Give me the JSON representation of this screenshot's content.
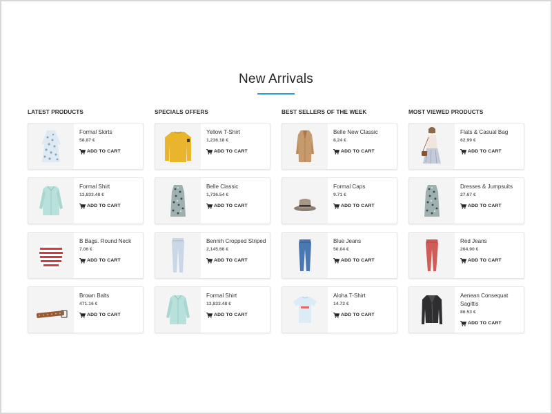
{
  "page": {
    "title": "New Arrivals",
    "accent_color": "#2a9fd6"
  },
  "add_to_cart_label": "ADD TO CART",
  "columns": [
    {
      "heading": "LATEST PRODUCTS",
      "products": [
        {
          "name": "Formal Skirts",
          "price": "58.87 €",
          "image": "floral-dress-image"
        },
        {
          "name": "Formal Shirt",
          "price": "13,833.48 €",
          "image": "mint-shirt-image"
        },
        {
          "name": "B Bags. Round Neck",
          "price": "7.06 €",
          "image": "striped-sweater-image"
        },
        {
          "name": "Brown Balts",
          "price": "471.16 €",
          "image": "brown-belt-image"
        }
      ]
    },
    {
      "heading": "SPECIALS OFFERS",
      "products": [
        {
          "name": "Yellow T-Shirt",
          "price": "1,236.18 €",
          "image": "yellow-sweater-image"
        },
        {
          "name": "Belle Classic",
          "price": "1,736.54 €",
          "image": "printed-dress-image"
        },
        {
          "name": "Bennih Cropped Striped",
          "price": "2,145.66 €",
          "image": "light-jeans-image"
        },
        {
          "name": "Formal Shirt",
          "price": "13,833.48 €",
          "image": "mint-shirt-image"
        }
      ]
    },
    {
      "heading": "BEST SELLERS OF THE WEEK",
      "products": [
        {
          "name": "Belle New Classic",
          "price": "8.24 €",
          "image": "camel-coat-image"
        },
        {
          "name": "Formal Caps",
          "price": "9.71 €",
          "image": "fedora-hat-image"
        },
        {
          "name": "Blue Jeans",
          "price": "50.04 €",
          "image": "blue-jeans-image"
        },
        {
          "name": "Aloha T-Shirt",
          "price": "14.72 €",
          "image": "white-tshirt-image"
        }
      ]
    },
    {
      "heading": "MOST VIEWED PRODUCTS",
      "products": [
        {
          "name": "Flats & Casual Bag",
          "price": "62.99 €",
          "image": "model-with-bag-image"
        },
        {
          "name": "Dresses & Jumpsuits",
          "price": "27.67 €",
          "image": "printed-dress-image"
        },
        {
          "name": "Red Jeans",
          "price": "264.90 €",
          "image": "red-jeans-image"
        },
        {
          "name": "Aenean Consequat Sagittis",
          "price": "86.53 €",
          "image": "leather-jacket-image"
        }
      ]
    }
  ]
}
